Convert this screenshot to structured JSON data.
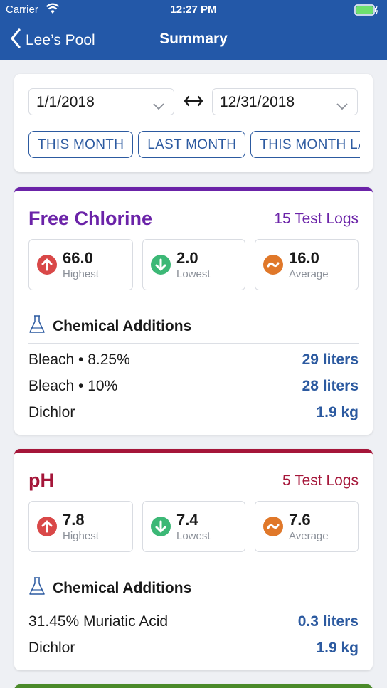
{
  "status": {
    "carrier": "Carrier",
    "time": "12:27 PM"
  },
  "nav": {
    "back_label": "Lee’s Pool",
    "title": "Summary"
  },
  "date_range": {
    "start": "1/1/2018",
    "end": "12/31/2018"
  },
  "chips": [
    "THIS MONTH",
    "LAST MONTH",
    "THIS MONTH LAST YEAR"
  ],
  "colors": {
    "nav": "#2358a8",
    "link": "#2c5aa0",
    "chlorine": "#6b23a8",
    "ph": "#a51639"
  },
  "chlorine": {
    "title": "Free Chlorine",
    "count": "15 Test Logs",
    "highest": "66.0",
    "highest_label": "Highest",
    "lowest": "2.0",
    "lowest_label": "Lowest",
    "average": "16.0",
    "average_label": "Average",
    "additions_title": "Chemical Additions",
    "additions": [
      {
        "name": "Bleach • 8.25%",
        "amount": "29 liters"
      },
      {
        "name": "Bleach • 10%",
        "amount": "28 liters"
      },
      {
        "name": "Dichlor",
        "amount": "1.9 kg"
      }
    ]
  },
  "ph": {
    "title": "pH",
    "count": "5 Test Logs",
    "highest": "7.8",
    "highest_label": "Highest",
    "lowest": "7.4",
    "lowest_label": "Lowest",
    "average": "7.6",
    "average_label": "Average",
    "additions_title": "Chemical Additions",
    "additions": [
      {
        "name": "31.45% Muriatic Acid",
        "amount": "0.3 liters"
      },
      {
        "name": "Dichlor",
        "amount": "1.9 kg"
      }
    ]
  }
}
